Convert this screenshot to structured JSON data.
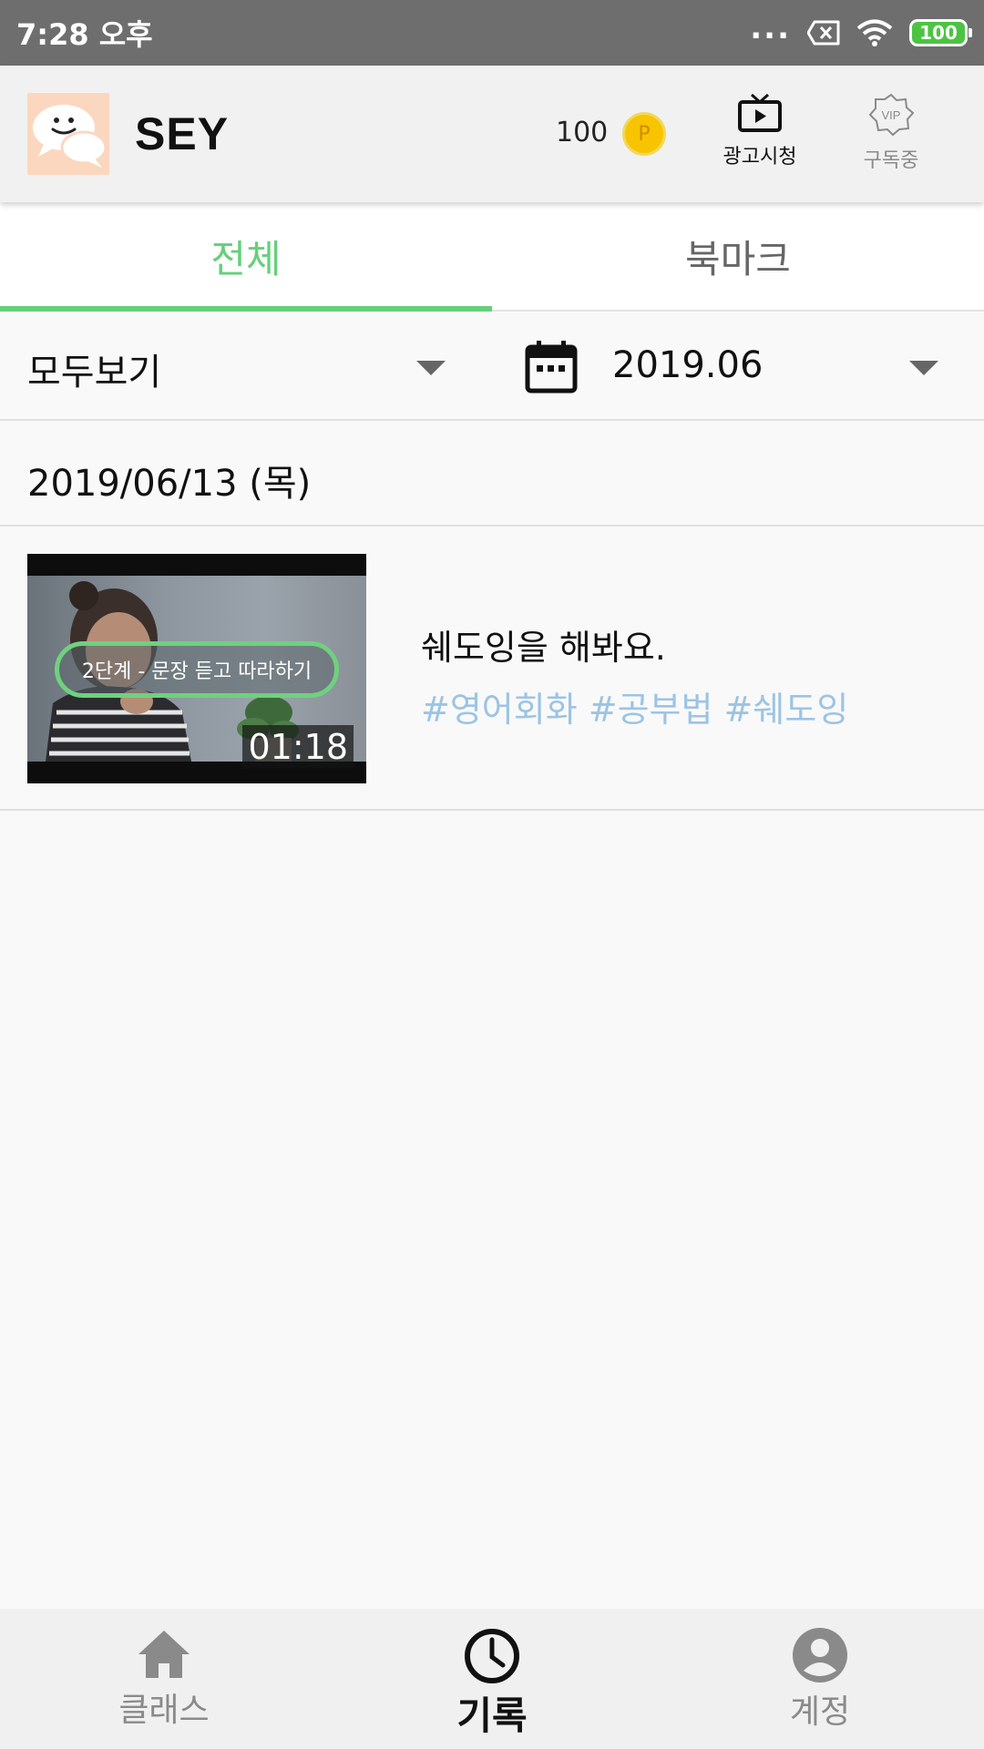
{
  "status_bar": {
    "time": "7:28 오후",
    "dots": "...",
    "battery": "100"
  },
  "header": {
    "app_title": "SEY",
    "points": "100",
    "coin_symbol": "P",
    "ad_label": "광고시청",
    "vip_badge": "VIP",
    "vip_label": "구독중"
  },
  "tabs": [
    {
      "label": "전체",
      "active": true
    },
    {
      "label": "북마크",
      "active": false
    }
  ],
  "filters": {
    "category": "모두보기",
    "month": "2019.06"
  },
  "date_header": "2019/06/13 (목)",
  "items": [
    {
      "badge": "2단계 - 문장 듣고 따라하기",
      "duration": "01:18",
      "title": "쉐도잉을 해봐요.",
      "tags": "#영어회화 #공부법 #쉐도잉"
    }
  ],
  "bottom_nav": [
    {
      "label": "클래스",
      "icon": "home-icon",
      "active": false
    },
    {
      "label": "기록",
      "icon": "clock-icon",
      "active": true
    },
    {
      "label": "계정",
      "icon": "account-icon",
      "active": false
    }
  ],
  "colors": {
    "accent_green": "#66cf7b",
    "tag_blue": "#9cc4e4",
    "coin_yellow": "#f8c400"
  }
}
